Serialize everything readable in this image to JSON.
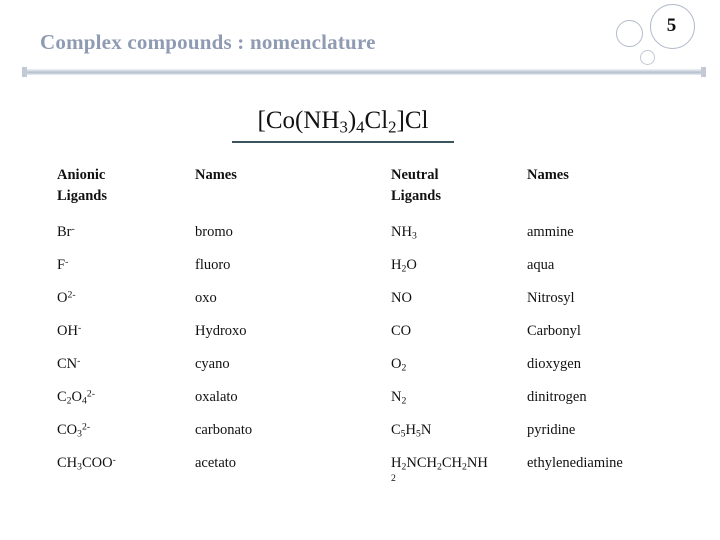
{
  "slide": {
    "title": "Complex compounds : nomenclature",
    "page_number": "5",
    "accent_title_color": "#8f9bb3",
    "rule_color": "#b6bfcd",
    "formula_rule_color": "#3b5560"
  },
  "formula": {
    "full_text": "[Co(NH3)4Cl2]Cl",
    "parts": {
      "p1": "[Co(NH",
      "sub1": "3",
      "p2": ")",
      "sub2": "4",
      "p3": "Cl",
      "sub3": "2",
      "p4": "]Cl"
    }
  },
  "table": {
    "headers": {
      "anionic_line1": "Anionic",
      "anionic_line2": "Ligands",
      "names1": "Names",
      "neutral_line1": "Neutral",
      "neutral_line2": "Ligands",
      "names2": "Names"
    },
    "rows": [
      {
        "anionic": {
          "base": "Br",
          "sup": "-"
        },
        "anionic_name": "bromo",
        "neutral": {
          "base": "NH",
          "sub": "3"
        },
        "neutral_name": "ammine"
      },
      {
        "anionic": {
          "base": "F",
          "sup": "-"
        },
        "anionic_name": "fluoro",
        "neutral": {
          "base": "H",
          "sub": "2",
          "tail": "O"
        },
        "neutral_name": "aqua"
      },
      {
        "anionic": {
          "base": "O",
          "sup": "2-"
        },
        "anionic_name": "oxo",
        "neutral": {
          "base": "NO"
        },
        "neutral_name": "Nitrosyl"
      },
      {
        "anionic": {
          "base": "OH",
          "sup": "-"
        },
        "anionic_name": "Hydroxo",
        "neutral": {
          "base": "CO"
        },
        "neutral_name": "Carbonyl"
      },
      {
        "anionic": {
          "base": "CN",
          "sup": "-"
        },
        "anionic_name": "cyano",
        "neutral": {
          "base": "O",
          "sub": "2"
        },
        "neutral_name": "dioxygen"
      },
      {
        "anionic": {
          "base": "C",
          "sub": "2",
          "mid": "O",
          "sub2": "4",
          "sup": "2-"
        },
        "anionic_name": "oxalato",
        "neutral": {
          "base": "N",
          "sub": "2"
        },
        "neutral_name": "dinitrogen"
      },
      {
        "anionic": {
          "base": "CO",
          "sub": "3",
          "sup": "2-"
        },
        "anionic_name": "carbonato",
        "neutral": {
          "base": "C",
          "sub": "5",
          "mid": "H",
          "sub2": "5",
          "tail": "N"
        },
        "neutral_name": "pyridine"
      },
      {
        "anionic": {
          "base": "CH",
          "sub": "3",
          "tail": "COO",
          "sup": "-"
        },
        "anionic_name": "acetato",
        "neutral": {
          "line1_a": "H",
          "line1_sub1": "2",
          "line1_b": "NCH",
          "line1_sub2": "2",
          "line1_c": "CH",
          "line1_sub3": "2",
          "line1_d": "NH",
          "line2": "2"
        },
        "neutral_name": "ethylenediamine"
      }
    ]
  }
}
